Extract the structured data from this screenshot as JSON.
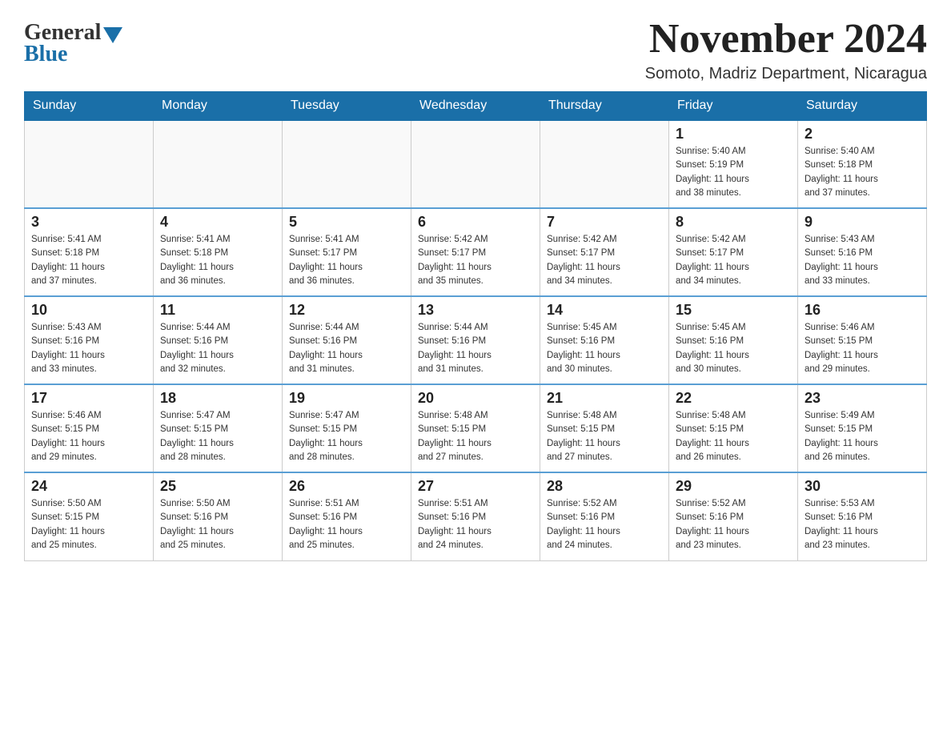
{
  "logo": {
    "general_text": "General",
    "blue_text": "Blue"
  },
  "header": {
    "month_year": "November 2024",
    "location": "Somoto, Madriz Department, Nicaragua"
  },
  "weekdays": [
    "Sunday",
    "Monday",
    "Tuesday",
    "Wednesday",
    "Thursday",
    "Friday",
    "Saturday"
  ],
  "weeks": [
    [
      {
        "day": "",
        "info": ""
      },
      {
        "day": "",
        "info": ""
      },
      {
        "day": "",
        "info": ""
      },
      {
        "day": "",
        "info": ""
      },
      {
        "day": "",
        "info": ""
      },
      {
        "day": "1",
        "info": "Sunrise: 5:40 AM\nSunset: 5:19 PM\nDaylight: 11 hours\nand 38 minutes."
      },
      {
        "day": "2",
        "info": "Sunrise: 5:40 AM\nSunset: 5:18 PM\nDaylight: 11 hours\nand 37 minutes."
      }
    ],
    [
      {
        "day": "3",
        "info": "Sunrise: 5:41 AM\nSunset: 5:18 PM\nDaylight: 11 hours\nand 37 minutes."
      },
      {
        "day": "4",
        "info": "Sunrise: 5:41 AM\nSunset: 5:18 PM\nDaylight: 11 hours\nand 36 minutes."
      },
      {
        "day": "5",
        "info": "Sunrise: 5:41 AM\nSunset: 5:17 PM\nDaylight: 11 hours\nand 36 minutes."
      },
      {
        "day": "6",
        "info": "Sunrise: 5:42 AM\nSunset: 5:17 PM\nDaylight: 11 hours\nand 35 minutes."
      },
      {
        "day": "7",
        "info": "Sunrise: 5:42 AM\nSunset: 5:17 PM\nDaylight: 11 hours\nand 34 minutes."
      },
      {
        "day": "8",
        "info": "Sunrise: 5:42 AM\nSunset: 5:17 PM\nDaylight: 11 hours\nand 34 minutes."
      },
      {
        "day": "9",
        "info": "Sunrise: 5:43 AM\nSunset: 5:16 PM\nDaylight: 11 hours\nand 33 minutes."
      }
    ],
    [
      {
        "day": "10",
        "info": "Sunrise: 5:43 AM\nSunset: 5:16 PM\nDaylight: 11 hours\nand 33 minutes."
      },
      {
        "day": "11",
        "info": "Sunrise: 5:44 AM\nSunset: 5:16 PM\nDaylight: 11 hours\nand 32 minutes."
      },
      {
        "day": "12",
        "info": "Sunrise: 5:44 AM\nSunset: 5:16 PM\nDaylight: 11 hours\nand 31 minutes."
      },
      {
        "day": "13",
        "info": "Sunrise: 5:44 AM\nSunset: 5:16 PM\nDaylight: 11 hours\nand 31 minutes."
      },
      {
        "day": "14",
        "info": "Sunrise: 5:45 AM\nSunset: 5:16 PM\nDaylight: 11 hours\nand 30 minutes."
      },
      {
        "day": "15",
        "info": "Sunrise: 5:45 AM\nSunset: 5:16 PM\nDaylight: 11 hours\nand 30 minutes."
      },
      {
        "day": "16",
        "info": "Sunrise: 5:46 AM\nSunset: 5:15 PM\nDaylight: 11 hours\nand 29 minutes."
      }
    ],
    [
      {
        "day": "17",
        "info": "Sunrise: 5:46 AM\nSunset: 5:15 PM\nDaylight: 11 hours\nand 29 minutes."
      },
      {
        "day": "18",
        "info": "Sunrise: 5:47 AM\nSunset: 5:15 PM\nDaylight: 11 hours\nand 28 minutes."
      },
      {
        "day": "19",
        "info": "Sunrise: 5:47 AM\nSunset: 5:15 PM\nDaylight: 11 hours\nand 28 minutes."
      },
      {
        "day": "20",
        "info": "Sunrise: 5:48 AM\nSunset: 5:15 PM\nDaylight: 11 hours\nand 27 minutes."
      },
      {
        "day": "21",
        "info": "Sunrise: 5:48 AM\nSunset: 5:15 PM\nDaylight: 11 hours\nand 27 minutes."
      },
      {
        "day": "22",
        "info": "Sunrise: 5:48 AM\nSunset: 5:15 PM\nDaylight: 11 hours\nand 26 minutes."
      },
      {
        "day": "23",
        "info": "Sunrise: 5:49 AM\nSunset: 5:15 PM\nDaylight: 11 hours\nand 26 minutes."
      }
    ],
    [
      {
        "day": "24",
        "info": "Sunrise: 5:50 AM\nSunset: 5:15 PM\nDaylight: 11 hours\nand 25 minutes."
      },
      {
        "day": "25",
        "info": "Sunrise: 5:50 AM\nSunset: 5:16 PM\nDaylight: 11 hours\nand 25 minutes."
      },
      {
        "day": "26",
        "info": "Sunrise: 5:51 AM\nSunset: 5:16 PM\nDaylight: 11 hours\nand 25 minutes."
      },
      {
        "day": "27",
        "info": "Sunrise: 5:51 AM\nSunset: 5:16 PM\nDaylight: 11 hours\nand 24 minutes."
      },
      {
        "day": "28",
        "info": "Sunrise: 5:52 AM\nSunset: 5:16 PM\nDaylight: 11 hours\nand 24 minutes."
      },
      {
        "day": "29",
        "info": "Sunrise: 5:52 AM\nSunset: 5:16 PM\nDaylight: 11 hours\nand 23 minutes."
      },
      {
        "day": "30",
        "info": "Sunrise: 5:53 AM\nSunset: 5:16 PM\nDaylight: 11 hours\nand 23 minutes."
      }
    ]
  ]
}
